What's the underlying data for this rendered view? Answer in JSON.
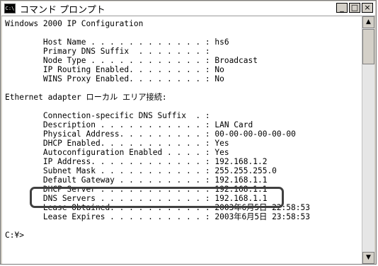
{
  "window": {
    "title": "コマンド プロンプト",
    "icon_text": "C:\\",
    "controls": {
      "minimize": "_",
      "maximize": "□",
      "close": "×"
    }
  },
  "console": {
    "lines": [
      "Windows 2000 IP Configuration",
      "",
      "        Host Name . . . . . . . . . . . . : hs6",
      "        Primary DNS Suffix  . . . . . . . :",
      "        Node Type . . . . . . . . . . . . : Broadcast",
      "        IP Routing Enabled. . . . . . . . : No",
      "        WINS Proxy Enabled. . . . . . . . : No",
      "",
      "Ethernet adapter ローカル エリア接続:",
      "",
      "        Connection-specific DNS Suffix  . :",
      "        Description . . . . . . . . . . . : LAN Card",
      "        Physical Address. . . . . . . . . : 00-00-00-00-00-00",
      "        DHCP Enabled. . . . . . . . . . . : Yes",
      "        Autoconfiguration Enabled . . . . : Yes",
      "        IP Address. . . . . . . . . . . . : 192.168.1.2",
      "        Subnet Mask . . . . . . . . . . . : 255.255.255.0",
      "        Default Gateway . . . . . . . . . : 192.168.1.1",
      "        DHCP Server . . . . . . . . . . . : 192.168.1.1",
      "        DNS Servers . . . . . . . . . . . : 192.168.1.1",
      "        Lease Obtained. . . . . . . . . . : 2003年6月5日 22:58:53",
      "        Lease Expires . . . . . . . . . . : 2003年6月5日 23:58:53",
      "",
      "C:¥>"
    ]
  },
  "scrollbar": {
    "up": "▲",
    "down": "▼"
  }
}
